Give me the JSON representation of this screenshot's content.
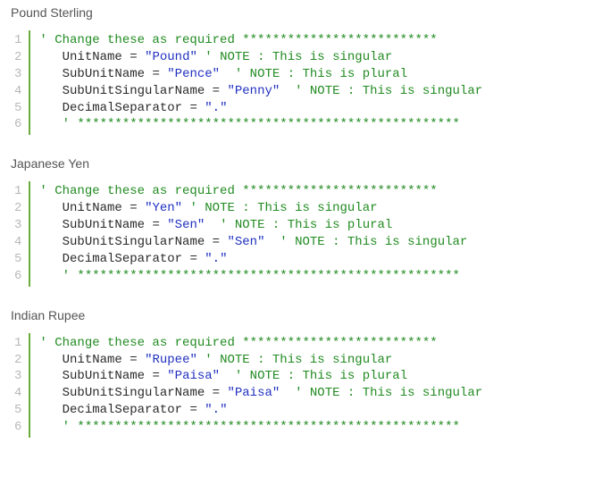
{
  "sections": [
    {
      "title": "Pound Sterling",
      "lines": [
        {
          "segments": [
            {
              "cls": "cm",
              "text": "' Change these as required **************************"
            }
          ]
        },
        {
          "segments": [
            {
              "cls": "cm",
              "text": "   "
            },
            {
              "cls": "id",
              "text": "UnitName "
            },
            {
              "cls": "op",
              "text": "= "
            },
            {
              "cls": "str",
              "text": "\"Pound\""
            },
            {
              "cls": "cm",
              "text": " ' NOTE : This is singular"
            }
          ]
        },
        {
          "segments": [
            {
              "cls": "cm",
              "text": "   "
            },
            {
              "cls": "id",
              "text": "SubUnitName "
            },
            {
              "cls": "op",
              "text": "= "
            },
            {
              "cls": "str",
              "text": "\"Pence\""
            },
            {
              "cls": "cm",
              "text": "  ' NOTE : This is plural"
            }
          ]
        },
        {
          "segments": [
            {
              "cls": "cm",
              "text": "   "
            },
            {
              "cls": "id",
              "text": "SubUnitSingularName "
            },
            {
              "cls": "op",
              "text": "= "
            },
            {
              "cls": "str",
              "text": "\"Penny\""
            },
            {
              "cls": "cm",
              "text": "  ' NOTE : This is singular"
            }
          ]
        },
        {
          "segments": [
            {
              "cls": "cm",
              "text": "   "
            },
            {
              "cls": "id",
              "text": "DecimalSeparator "
            },
            {
              "cls": "op",
              "text": "= "
            },
            {
              "cls": "str",
              "text": "\".\""
            }
          ]
        },
        {
          "segments": [
            {
              "cls": "cm",
              "text": "   ' ***************************************************"
            }
          ]
        }
      ]
    },
    {
      "title": "Japanese Yen",
      "lines": [
        {
          "segments": [
            {
              "cls": "cm",
              "text": "' Change these as required **************************"
            }
          ]
        },
        {
          "segments": [
            {
              "cls": "cm",
              "text": "   "
            },
            {
              "cls": "id",
              "text": "UnitName "
            },
            {
              "cls": "op",
              "text": "= "
            },
            {
              "cls": "str",
              "text": "\"Yen\""
            },
            {
              "cls": "cm",
              "text": " ' NOTE : This is singular"
            }
          ]
        },
        {
          "segments": [
            {
              "cls": "cm",
              "text": "   "
            },
            {
              "cls": "id",
              "text": "SubUnitName "
            },
            {
              "cls": "op",
              "text": "= "
            },
            {
              "cls": "str",
              "text": "\"Sen\""
            },
            {
              "cls": "cm",
              "text": "  ' NOTE : This is plural"
            }
          ]
        },
        {
          "segments": [
            {
              "cls": "cm",
              "text": "   "
            },
            {
              "cls": "id",
              "text": "SubUnitSingularName "
            },
            {
              "cls": "op",
              "text": "= "
            },
            {
              "cls": "str",
              "text": "\"Sen\""
            },
            {
              "cls": "cm",
              "text": "  ' NOTE : This is singular"
            }
          ]
        },
        {
          "segments": [
            {
              "cls": "cm",
              "text": "   "
            },
            {
              "cls": "id",
              "text": "DecimalSeparator "
            },
            {
              "cls": "op",
              "text": "= "
            },
            {
              "cls": "str",
              "text": "\".\""
            }
          ]
        },
        {
          "segments": [
            {
              "cls": "cm",
              "text": "   ' ***************************************************"
            }
          ]
        }
      ]
    },
    {
      "title": "Indian Rupee",
      "lines": [
        {
          "segments": [
            {
              "cls": "cm",
              "text": "' Change these as required **************************"
            }
          ]
        },
        {
          "segments": [
            {
              "cls": "cm",
              "text": "   "
            },
            {
              "cls": "id",
              "text": "UnitName "
            },
            {
              "cls": "op",
              "text": "= "
            },
            {
              "cls": "str",
              "text": "\"Rupee\""
            },
            {
              "cls": "cm",
              "text": " ' NOTE : This is singular"
            }
          ]
        },
        {
          "segments": [
            {
              "cls": "cm",
              "text": "   "
            },
            {
              "cls": "id",
              "text": "SubUnitName "
            },
            {
              "cls": "op",
              "text": "= "
            },
            {
              "cls": "str",
              "text": "\"Paisa\""
            },
            {
              "cls": "cm",
              "text": "  ' NOTE : This is plural"
            }
          ]
        },
        {
          "segments": [
            {
              "cls": "cm",
              "text": "   "
            },
            {
              "cls": "id",
              "text": "SubUnitSingularName "
            },
            {
              "cls": "op",
              "text": "= "
            },
            {
              "cls": "str",
              "text": "\"Paisa\""
            },
            {
              "cls": "cm",
              "text": "  ' NOTE : This is singular"
            }
          ]
        },
        {
          "segments": [
            {
              "cls": "cm",
              "text": "   "
            },
            {
              "cls": "id",
              "text": "DecimalSeparator "
            },
            {
              "cls": "op",
              "text": "= "
            },
            {
              "cls": "str",
              "text": "\".\""
            }
          ]
        },
        {
          "segments": [
            {
              "cls": "cm",
              "text": "   ' ***************************************************"
            }
          ]
        }
      ]
    }
  ]
}
